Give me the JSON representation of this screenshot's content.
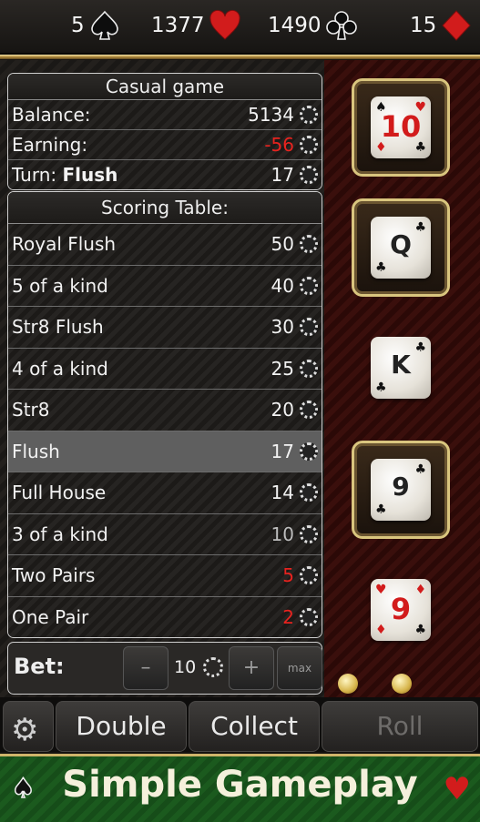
{
  "stats": [
    {
      "value": "5",
      "suit": "spade-icon",
      "color": "#111111"
    },
    {
      "value": "1377",
      "suit": "heart-icon",
      "color": "#d21c1c"
    },
    {
      "value": "1490",
      "suit": "club-icon",
      "color": "#111111"
    },
    {
      "value": "15",
      "suit": "diamond-icon",
      "color": "#d21c1c"
    }
  ],
  "info": {
    "header": "Casual game",
    "balance_label": "Balance:",
    "balance_value": "5134",
    "earning_label": "Earning:",
    "earning_value": "-56",
    "turn_label": "Turn:",
    "turn_hand": "Flush",
    "turn_value": "17"
  },
  "scoring": {
    "header": "Scoring Table:",
    "rows": [
      {
        "hand": "Royal Flush",
        "points": "50"
      },
      {
        "hand": "5 of a kind",
        "points": "40"
      },
      {
        "hand": "Str8 Flush",
        "points": "30"
      },
      {
        "hand": "4 of a kind",
        "points": "25"
      },
      {
        "hand": "Str8",
        "points": "20"
      },
      {
        "hand": "Flush",
        "points": "17"
      },
      {
        "hand": "Full House",
        "points": "14"
      },
      {
        "hand": "3 of a kind",
        "points": "10"
      },
      {
        "hand": "Two Pairs",
        "points": "5"
      },
      {
        "hand": "One Pair",
        "points": "2"
      }
    ]
  },
  "bet": {
    "label": "Bet:",
    "minus": "–",
    "value": "10",
    "plus": "+",
    "max": "max"
  },
  "dice": [
    {
      "face": "10",
      "held": true
    },
    {
      "face": "Q",
      "held": true
    },
    {
      "face": "K",
      "held": false
    },
    {
      "face": "9",
      "held": true
    },
    {
      "face": "9",
      "held": false
    }
  ],
  "actions": {
    "double": "Double",
    "collect": "Collect",
    "roll": "Roll"
  },
  "footer": {
    "title": "Simple Gameplay"
  }
}
